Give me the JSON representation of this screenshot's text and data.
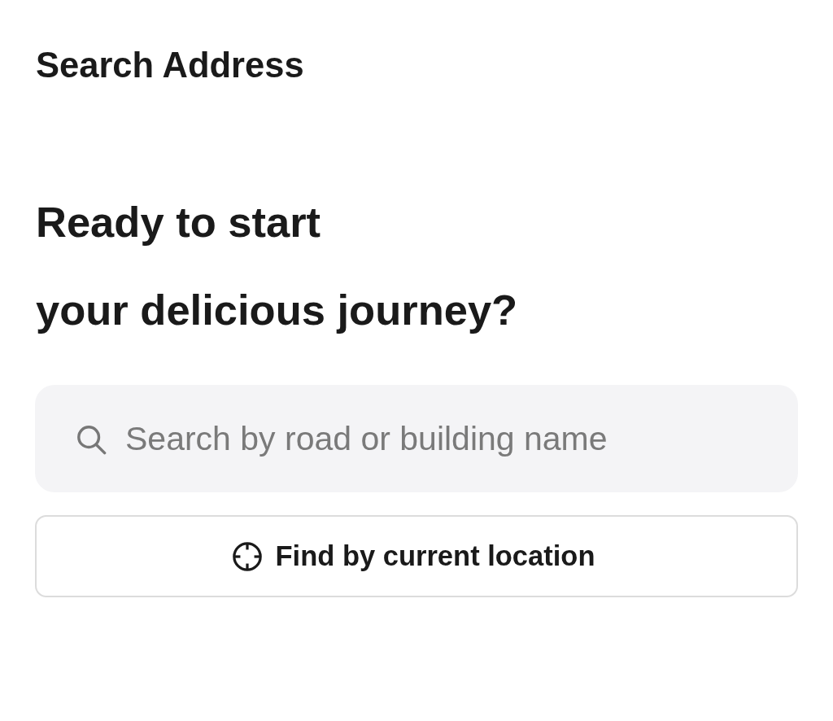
{
  "header": {
    "title": "Search Address"
  },
  "headline": {
    "lines": [
      "Ready to start",
      "your delicious journey?"
    ]
  },
  "search": {
    "placeholder": "Search by road or building name"
  },
  "location_button": {
    "label": "Find by current location"
  }
}
